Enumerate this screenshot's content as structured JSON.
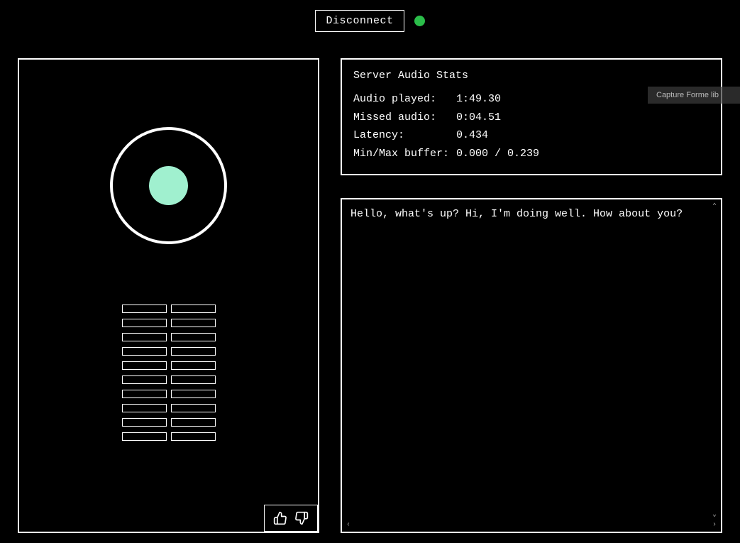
{
  "topbar": {
    "disconnect_label": "Disconnect",
    "status_color": "#2bbd4a"
  },
  "stats": {
    "title": "Server Audio Stats",
    "rows": [
      {
        "label": "Audio played:",
        "value": "1:49.30"
      },
      {
        "label": "Missed audio:",
        "value": "0:04.51"
      },
      {
        "label": "Latency:",
        "value": "0.434"
      },
      {
        "label": "Min/Max buffer:",
        "value": "0.000 / 0.239"
      }
    ]
  },
  "transcript": {
    "text": "Hello, what's up? Hi, I'm doing well. How about you?"
  },
  "visualizer": {
    "inner_color": "#a0f0cf",
    "bar_rows": 10
  },
  "feedback": {
    "thumbs_up_name": "thumbs-up-icon",
    "thumbs_down_name": "thumbs-down-icon"
  },
  "overlay": {
    "capture_hint": "Capture Forme lib"
  }
}
